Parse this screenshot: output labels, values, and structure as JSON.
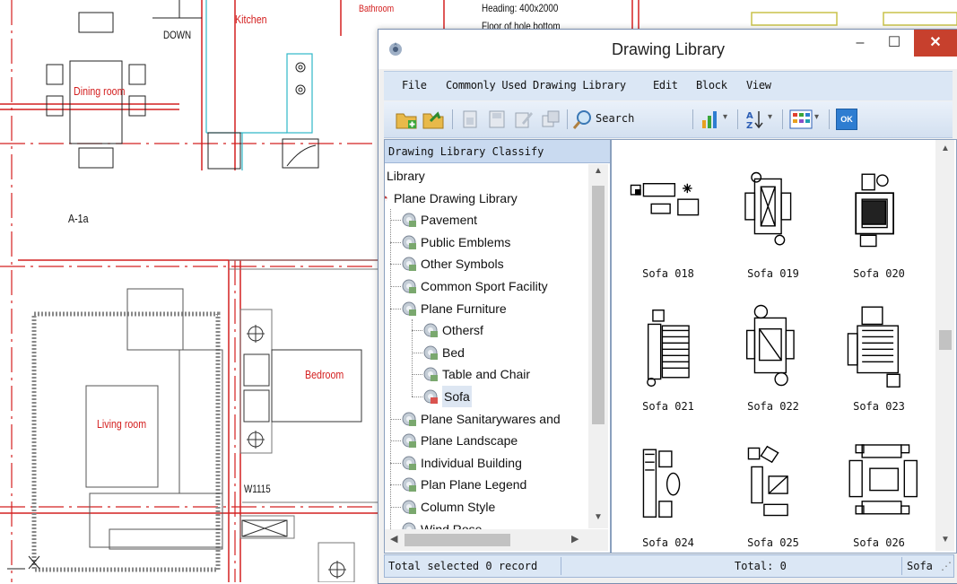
{
  "cad": {
    "labels": {
      "kitchen": "Kitchen",
      "bathroom": "Bathroom",
      "down": "DOWN",
      "dining_room": "Dining room",
      "a1a": "A-1a",
      "living_room": "Living room",
      "bedroom": "Bedroom",
      "w1115": "W1115",
      "heading": "Heading: 400x2000",
      "floor_hole": "Floor of hole bottom"
    }
  },
  "window": {
    "title": "Drawing Library",
    "minimize": "–",
    "maximize": "☐",
    "close": "✕"
  },
  "menu": [
    "File",
    "Commonly Used Drawing Library",
    "Edit",
    "Block",
    "View"
  ],
  "toolbar": {
    "search_label": "Search",
    "ok_label": "OK"
  },
  "tree": {
    "header": "Drawing Library Classify",
    "items": [
      {
        "label": "Library",
        "level": 0
      },
      {
        "label": "Plane Drawing Library",
        "level": 0
      },
      {
        "label": "Pavement",
        "level": 1
      },
      {
        "label": "Public Emblems",
        "level": 1
      },
      {
        "label": "Other Symbols",
        "level": 1
      },
      {
        "label": "Common Sport Facility",
        "level": 1
      },
      {
        "label": "Plane Furniture",
        "level": 1
      },
      {
        "label": "Othersf",
        "level": 2
      },
      {
        "label": "Bed",
        "level": 2
      },
      {
        "label": "Table and Chair",
        "level": 2
      },
      {
        "label": "Sofa",
        "level": 2,
        "selected": true
      },
      {
        "label": "Plane Sanitarywares and",
        "level": 1
      },
      {
        "label": "Plane Landscape",
        "level": 1
      },
      {
        "label": "Individual Building",
        "level": 1
      },
      {
        "label": "Plan Plane Legend",
        "level": 1
      },
      {
        "label": "Column Style",
        "level": 1
      },
      {
        "label": "Wind Rose",
        "level": 1
      }
    ]
  },
  "grid": {
    "items": [
      {
        "label": "Sofa 018"
      },
      {
        "label": "Sofa 019"
      },
      {
        "label": "Sofa 020"
      },
      {
        "label": "Sofa 021"
      },
      {
        "label": "Sofa 022"
      },
      {
        "label": "Sofa 023"
      },
      {
        "label": "Sofa 024"
      },
      {
        "label": "Sofa 025"
      },
      {
        "label": "Sofa 026"
      }
    ]
  },
  "status": {
    "selected": "Total selected 0 record",
    "total": "Total: 0",
    "current": "Sofa"
  },
  "colors": {
    "cad_red": "#d42020",
    "cad_cyan": "#30b8c8",
    "close_button": "#c7402d",
    "menubar": "#dbe7f5"
  }
}
